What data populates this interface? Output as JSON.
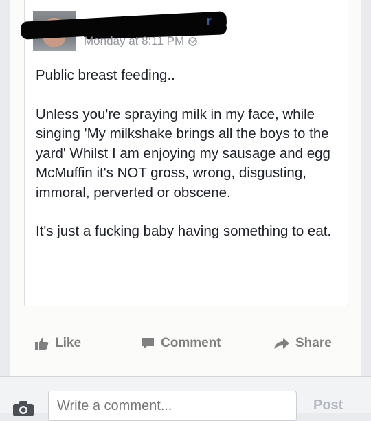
{
  "post": {
    "author_name_visible": "r",
    "timestamp": "Monday at 8:11 PM",
    "privacy_icon": "globe-icon",
    "paragraphs": [
      "Public breast feeding..",
      "Unless you're spraying milk in my face, while singing 'My milkshake brings all the boys to the yard' Whilst I am enjoying my sausage and egg McMuffin it's NOT gross, wrong, disgusting, immoral, perverted or obscene.",
      "It's just a fucking baby having something to eat."
    ]
  },
  "actions": {
    "like_label": "Like",
    "comment_label": "Comment",
    "share_label": "Share",
    "icon_color": "#7f7f7f"
  },
  "comment_box": {
    "placeholder": "Write a comment...",
    "post_label": "Post"
  }
}
